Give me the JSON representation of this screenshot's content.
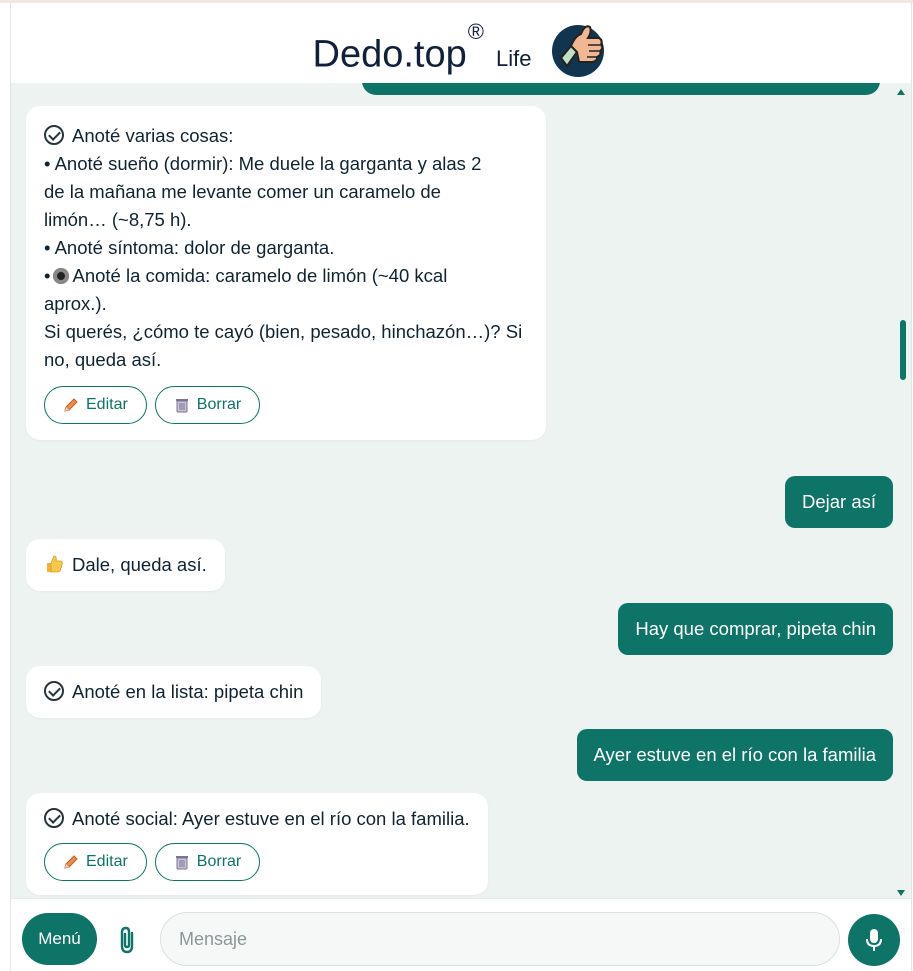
{
  "header": {
    "brand": "Dedo.top",
    "registered_mark": "®",
    "product": "Life",
    "logo_icon": "thumbs-up-hand-icon"
  },
  "messages": {
    "bot1": {
      "lines": [
        "Anoté varias cosas:",
        "• Anoté sueño (dormir): Me duele la garganta y alas 2",
        "de la mañana me levante comer un caramelo de",
        "limón… (~8,75 h).",
        "• Anoté síntoma: dolor de garganta.",
        "Anoté la comida: caramelo de limón (~40 kcal",
        "aprox.).",
        "",
        "Si querés, ¿cómo te cayó (bien, pesado, hinchazón…)? Si",
        "no, queda así."
      ],
      "food_bullet": "•",
      "edit_label": "Editar",
      "delete_label": "Borrar"
    },
    "user1": "Dejar así",
    "bot2": "Dale, queda así.",
    "user2": "Hay que comprar, pipeta chin",
    "bot3": "Anoté en la lista: pipeta chin",
    "user3": "Ayer estuve en el río con la familia",
    "bot4": {
      "text": "Anoté social: Ayer estuve en el río con la familia.",
      "edit_label": "Editar",
      "delete_label": "Borrar"
    }
  },
  "composer": {
    "menu_label": "Menú",
    "placeholder": "Mensaje",
    "attach_icon": "paperclip-icon",
    "mic_icon": "microphone-icon"
  },
  "colors": {
    "accent": "#0e7468",
    "background": "#edf3f1",
    "bubble_bot": "#ffffff",
    "text": "#0f2430"
  }
}
